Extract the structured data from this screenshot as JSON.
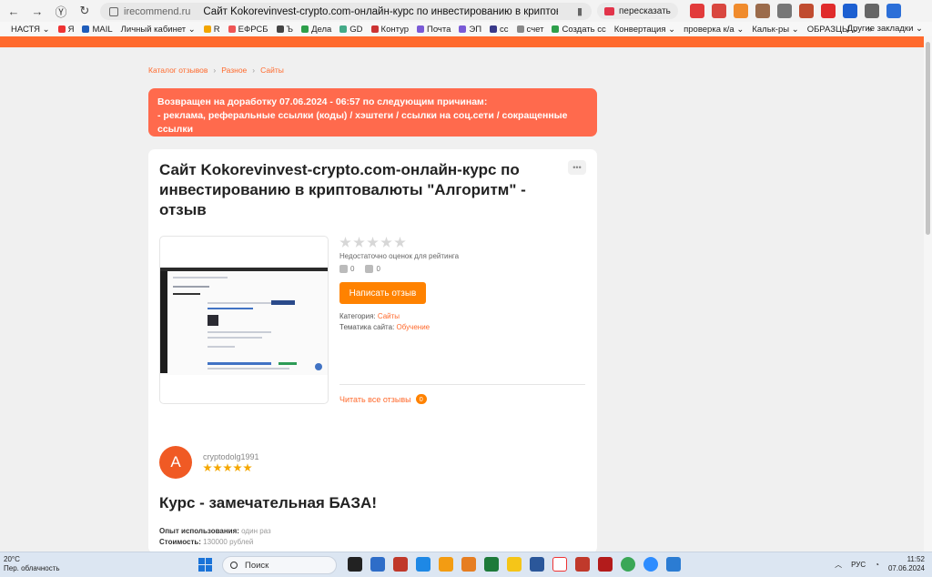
{
  "browser": {
    "url_domain": "irecommend.ru",
    "tab_title": "Сайт Kokorevinvest-crypto.com-онлайн-курс по инвестированию в криптовалюты...",
    "retell_label": "пересказать"
  },
  "bookmarks": {
    "items": [
      "НАСТЯ",
      "Я",
      "MAIL",
      "Личный кабинет",
      "R",
      "ЕФРСБ",
      "Ъ",
      "Дела",
      "GD",
      "Контур",
      "Почта",
      "ЭП",
      "cc",
      "счет",
      "Создать сс",
      "Конвертация",
      "проверка к/а",
      "Кальк-ры",
      "ОБРАЗЦЫ"
    ],
    "more": "»",
    "other": "Другие закладки"
  },
  "breadcrumb": [
    "Каталог отзывов",
    "Разное",
    "Сайты"
  ],
  "alert": {
    "line1": "Возвращен на доработку 07.06.2024 - 06:57 по следующим причинам:",
    "line2": "- реклама, реферальные ссылки (коды) / хэштеги / ссылки на соц.сети / сокращенные ссылки"
  },
  "product": {
    "title": "Сайт Kokorevinvest-crypto.com-онлайн-курс по инвестированию в криптовалюты \"Алгоритм\" - отзыв",
    "more_label": "•••",
    "rating_note": "Недостаточно оценок для рейтинга",
    "likes": "0",
    "dislikes": "0",
    "write_review": "Написать отзыв",
    "category_label": "Категория:",
    "category_value": "Сайты",
    "theme_label": "Тематика сайта:",
    "theme_value": "Обучение",
    "read_all": "Читать все отзывы",
    "read_all_count": "0",
    "rating_stars": 0
  },
  "review": {
    "avatar_letter": "A",
    "username": "cryptodolg1991",
    "stars": 5,
    "title": "Курс - замечательная БАЗА!",
    "exp_label": "Опыт использования:",
    "exp_value": "один раз",
    "cost_label": "Стоимость:",
    "cost_value": "130000 рублей"
  },
  "taskbar": {
    "temp": "20°C",
    "weather": "Пер. облачность",
    "search_placeholder": "Поиск",
    "lang": "РУС",
    "time": "11:52",
    "date": "07.06.2024"
  },
  "colors": {
    "brand": "#ff6a2d",
    "button": "#ff8200",
    "alert": "#ff6a4d",
    "star_filled": "#f5a800",
    "star_empty": "#d7d7d7"
  }
}
